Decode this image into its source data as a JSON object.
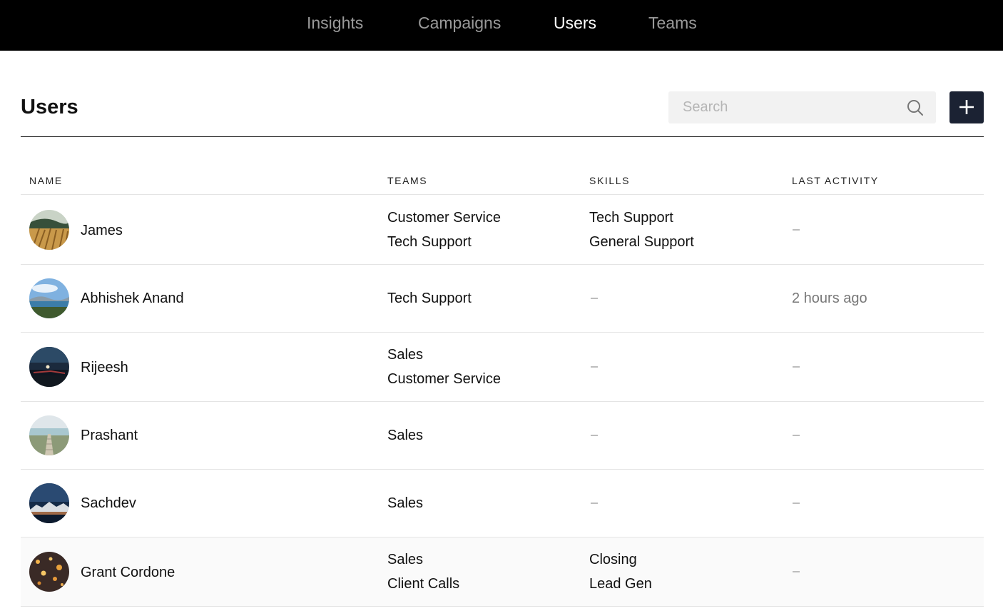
{
  "nav": {
    "items": [
      "Insights",
      "Campaigns",
      "Users",
      "Teams"
    ],
    "active": "Users"
  },
  "header": {
    "title": "Users",
    "search_placeholder": "Search",
    "add_icon": "plus-icon",
    "search_icon": "search-icon"
  },
  "table": {
    "columns": [
      "NAME",
      "TEAMS",
      "SKILLS",
      "LAST ACTIVITY"
    ],
    "rows": [
      {
        "name": "James",
        "teams": [
          "Customer Service",
          "Tech Support"
        ],
        "skills": [
          "Tech Support",
          "General Support"
        ],
        "last_activity": ""
      },
      {
        "name": "Abhishek Anand",
        "teams": [
          "Tech Support"
        ],
        "skills": [],
        "last_activity": "2 hours ago"
      },
      {
        "name": "Rijeesh",
        "teams": [
          "Sales",
          "Customer Service"
        ],
        "skills": [],
        "last_activity": ""
      },
      {
        "name": "Prashant",
        "teams": [
          "Sales"
        ],
        "skills": [],
        "last_activity": ""
      },
      {
        "name": "Sachdev",
        "teams": [
          "Sales"
        ],
        "skills": [],
        "last_activity": ""
      },
      {
        "name": "Grant Cordone",
        "teams": [
          "Sales",
          "Client Calls"
        ],
        "skills": [
          "Closing",
          "Lead Gen"
        ],
        "last_activity": ""
      }
    ]
  },
  "colors": {
    "nav_bg": "#000000",
    "nav_text": "#9a9a9a",
    "nav_active": "#ffffff",
    "add_button_bg": "#1b2233",
    "search_bg": "#f2f2f2",
    "placeholder_dash": "#bdbdbd",
    "activity_text": "#777777"
  }
}
